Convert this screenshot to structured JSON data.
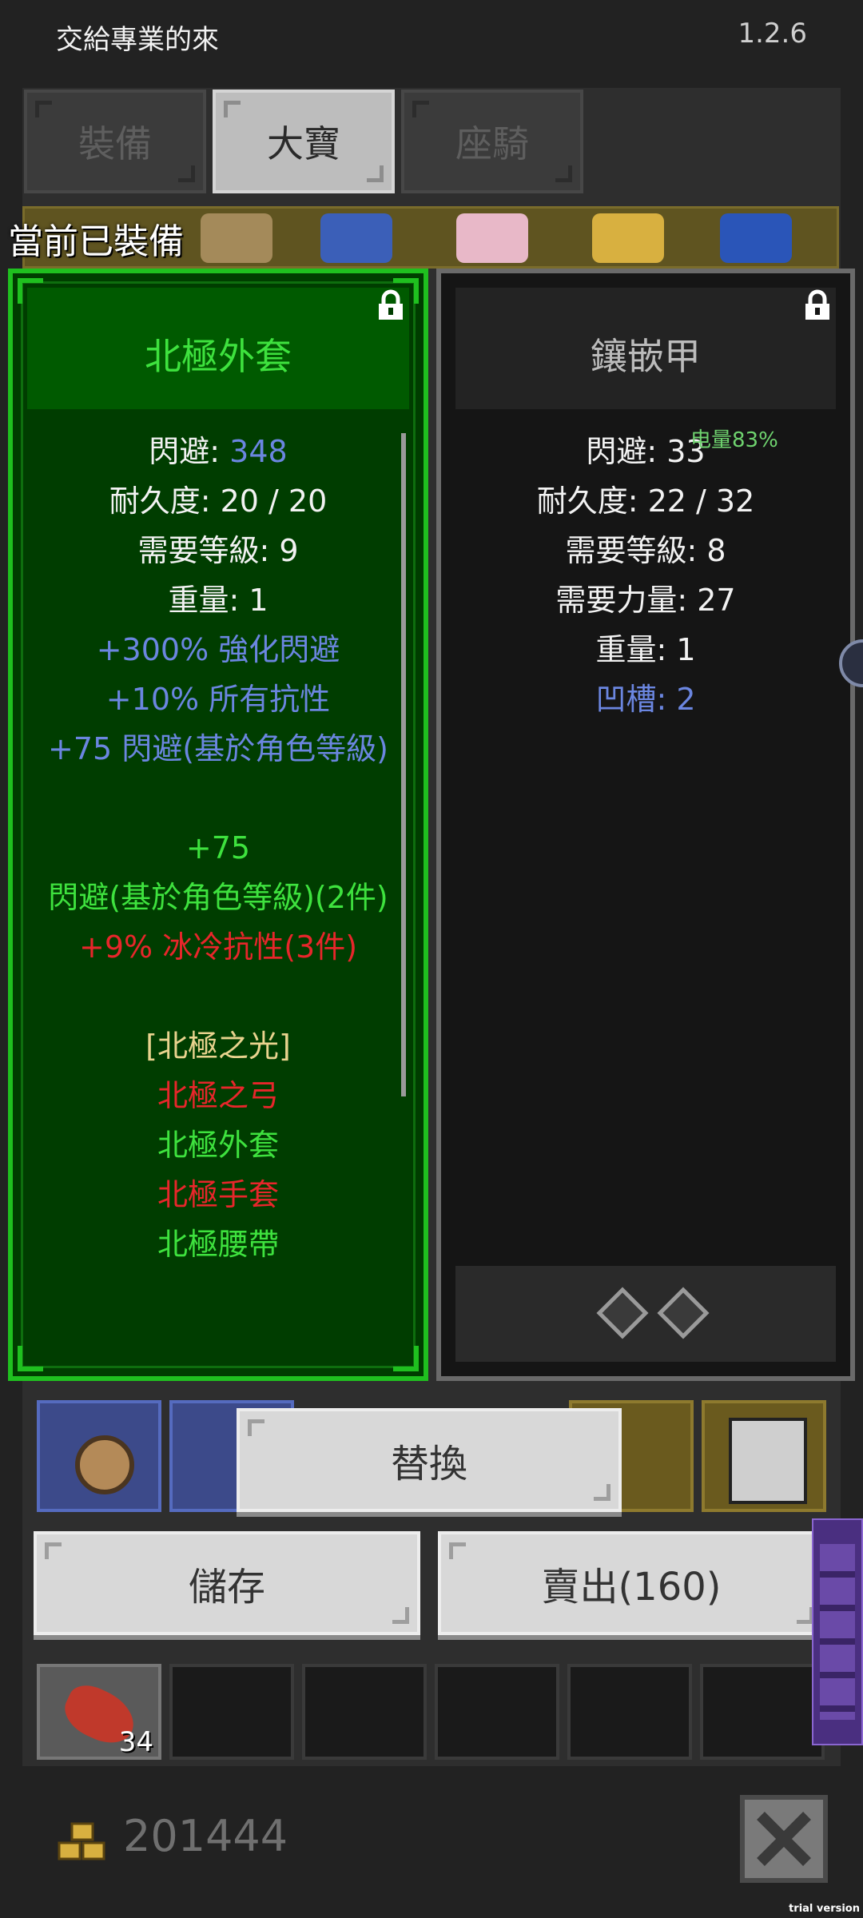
{
  "header": {
    "title": "交給專業的來",
    "version": "1.2.6"
  },
  "tabs": [
    {
      "label": "裝備",
      "active": false
    },
    {
      "label": "大寶",
      "active": true
    },
    {
      "label": "座騎",
      "active": false
    }
  ],
  "equipped_label": "當前已裝備",
  "left_panel": {
    "title": "北極外套",
    "lock_icon": "lock-icon",
    "lines": [
      {
        "text": "閃避: ",
        "value": "348",
        "color": "white"
      },
      {
        "text": "耐久度: 20 / 20",
        "color": "white"
      },
      {
        "text": "需要等級: 9",
        "color": "white"
      },
      {
        "text": "重量: 1",
        "color": "white"
      },
      {
        "text": "+300% 強化閃避",
        "color": "blue"
      },
      {
        "text": "+10% 所有抗性",
        "color": "blue"
      },
      {
        "text": "+75 閃避(基於角色等級)",
        "color": "blue"
      },
      {
        "text": "",
        "color": "white"
      },
      {
        "text": "+75",
        "color": "green"
      },
      {
        "text": "閃避(基於角色等級)(2件)",
        "color": "green"
      },
      {
        "text": "+9% 冰冷抗性(3件)",
        "color": "red"
      },
      {
        "text": "",
        "color": "white"
      },
      {
        "text": "[北極之光]",
        "color": "gold"
      },
      {
        "text": "北極之弓",
        "color": "red"
      },
      {
        "text": "北極外套",
        "color": "green"
      },
      {
        "text": "北極手套",
        "color": "red"
      },
      {
        "text": "北極腰帶",
        "color": "green"
      }
    ]
  },
  "right_panel": {
    "title": "鑲嵌甲",
    "lock_icon": "lock-icon",
    "lines": [
      {
        "text": "閃避: 33",
        "color": "white"
      },
      {
        "text": "耐久度: 22 / 32",
        "color": "white"
      },
      {
        "text": "需要等級: 8",
        "color": "white"
      },
      {
        "text": "需要力量: 27",
        "color": "white"
      },
      {
        "text": "重量: 1",
        "color": "white"
      },
      {
        "text": "凹槽: 2",
        "color": "blue"
      }
    ],
    "sockets": 2
  },
  "overlay_battery": "电量83%",
  "buttons": {
    "replace": "替換",
    "store": "儲存",
    "sell": "賣出(160)"
  },
  "inventory_counts": {
    "stack_item": "34"
  },
  "gold": {
    "icon": "gold-coins-icon",
    "amount": "201444"
  },
  "close_icon": "close-x-icon",
  "watermark": "trial version",
  "colors": {
    "left_border": "#1fc01f",
    "left_bg": "#003d00",
    "stat_blue": "#6b86e0",
    "set_green": "#3ee23e",
    "set_red": "#e8262b",
    "set_gold": "#e9d38e"
  }
}
